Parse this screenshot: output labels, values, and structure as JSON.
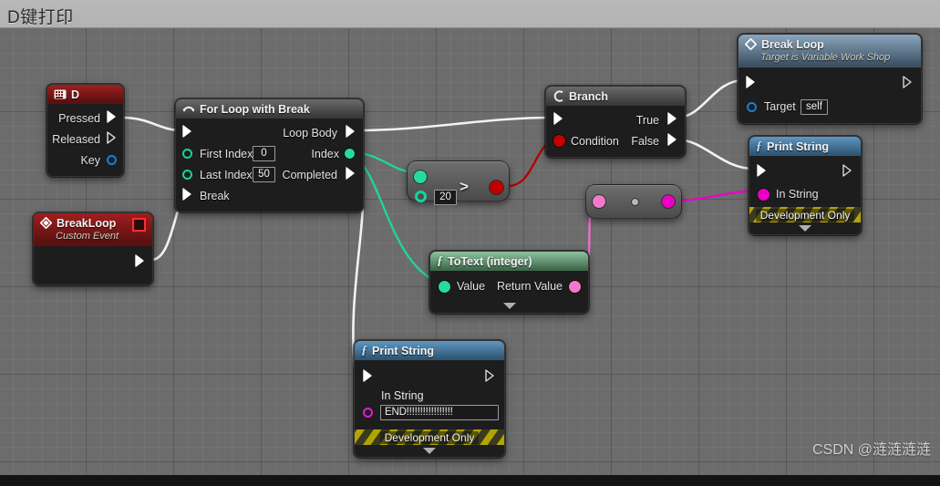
{
  "window": {
    "title": "D键打印"
  },
  "watermark": "CSDN @涟涟涟涟",
  "colors": {
    "exec_wire": "#f2f2f2",
    "int_wire": "#1fd6a0",
    "bool_wire": "#b40000",
    "text_wire": "#f06ecb",
    "string_wire": "#ec00c8",
    "canvas_bg": "#6c6c6c",
    "node_bg": "#1d1d1d",
    "event_header": "#a01f1f",
    "function_header": "#5f97c2",
    "convert_header": "#8fc3a0"
  },
  "nodes": {
    "key_event_d": {
      "title": "D",
      "icon": "keyboard-icon",
      "pins": {
        "pressed": "Pressed",
        "released": "Released",
        "key": "Key"
      }
    },
    "custom_event_breakloop": {
      "title": "BreakLoop",
      "subtitle": "Custom Event",
      "icon": "event-diamond-icon"
    },
    "for_loop_with_break": {
      "title": "For Loop with Break",
      "icon": "loop-icon",
      "inputs": {
        "first_index_label": "First Index",
        "first_index_value": "0",
        "last_index_label": "Last Index",
        "last_index_value": "50",
        "break_label": "Break"
      },
      "outputs": {
        "loop_body": "Loop Body",
        "index": "Index",
        "completed": "Completed"
      }
    },
    "greater_than": {
      "operator": ">",
      "b_value": "20"
    },
    "branch": {
      "title": "Branch",
      "icon": "branch-icon",
      "inputs": {
        "condition": "Condition"
      },
      "outputs": {
        "true": "True",
        "false": "False"
      }
    },
    "break_loop": {
      "title": "Break Loop",
      "subtitle": "Target is Variable Work Shop",
      "icon": "function-diamond-icon",
      "inputs": {
        "target_label": "Target",
        "target_value": "self"
      }
    },
    "to_text_integer": {
      "title": "ToText (integer)",
      "icon": "f-icon",
      "inputs": {
        "value": "Value"
      },
      "outputs": {
        "return_value": "Return Value"
      }
    },
    "text_to_string": {
      "title": ""
    },
    "print_string_right": {
      "title": "Print String",
      "icon": "f-icon",
      "inputs": {
        "in_string_label": "In String"
      },
      "footer": "Development Only"
    },
    "print_string_bottom": {
      "title": "Print String",
      "icon": "f-icon",
      "inputs": {
        "in_string_label": "In String",
        "in_string_value": "END!!!!!!!!!!!!!!!!!"
      },
      "footer": "Development Only"
    }
  }
}
